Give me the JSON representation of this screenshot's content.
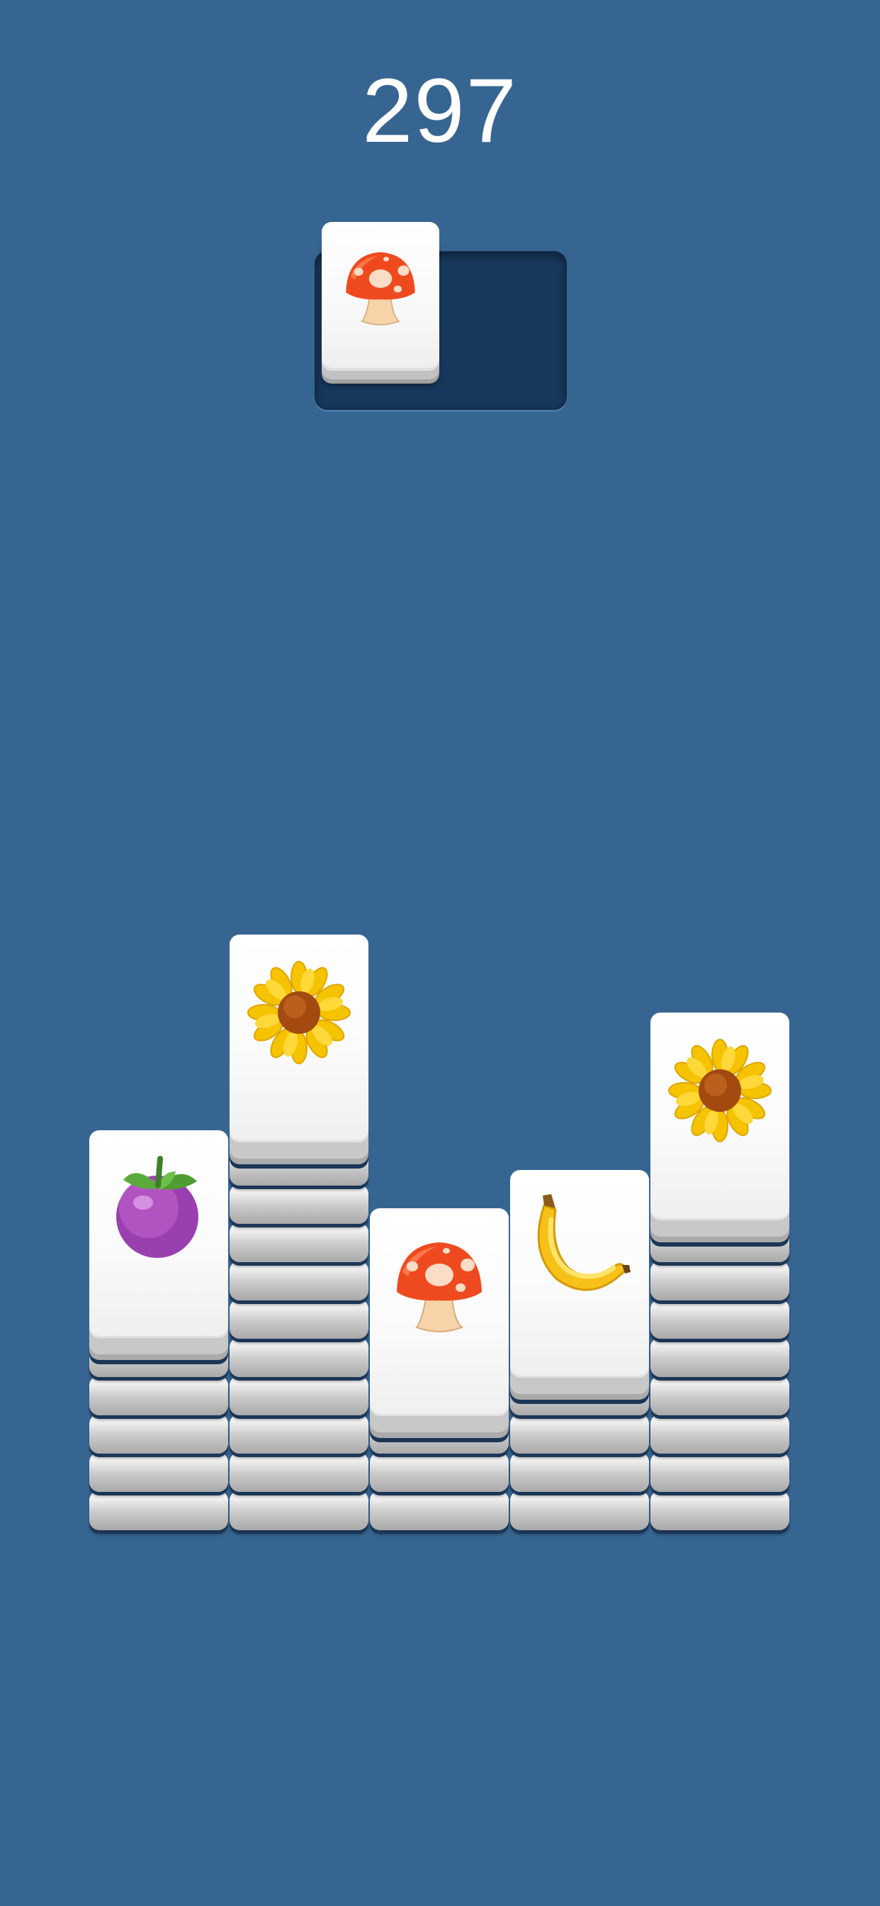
{
  "score": "297",
  "colors": {
    "background": "#366592",
    "tray": "#17375c",
    "tile_face": "#ffffff"
  },
  "tray": {
    "capacity_visible": 2,
    "slots": [
      "mushroom-icon",
      null
    ]
  },
  "board": {
    "columns": [
      {
        "stack_layers": 5,
        "top_tile": "mangosteen-icon"
      },
      {
        "stack_layers": 10,
        "top_tile": "sunflower-icon"
      },
      {
        "stack_layers": 4,
        "top_tile": "mushroom-icon"
      },
      {
        "stack_layers": 5,
        "top_tile": "banana-icon"
      },
      {
        "stack_layers": 8,
        "top_tile": "sunflower-icon"
      }
    ]
  }
}
